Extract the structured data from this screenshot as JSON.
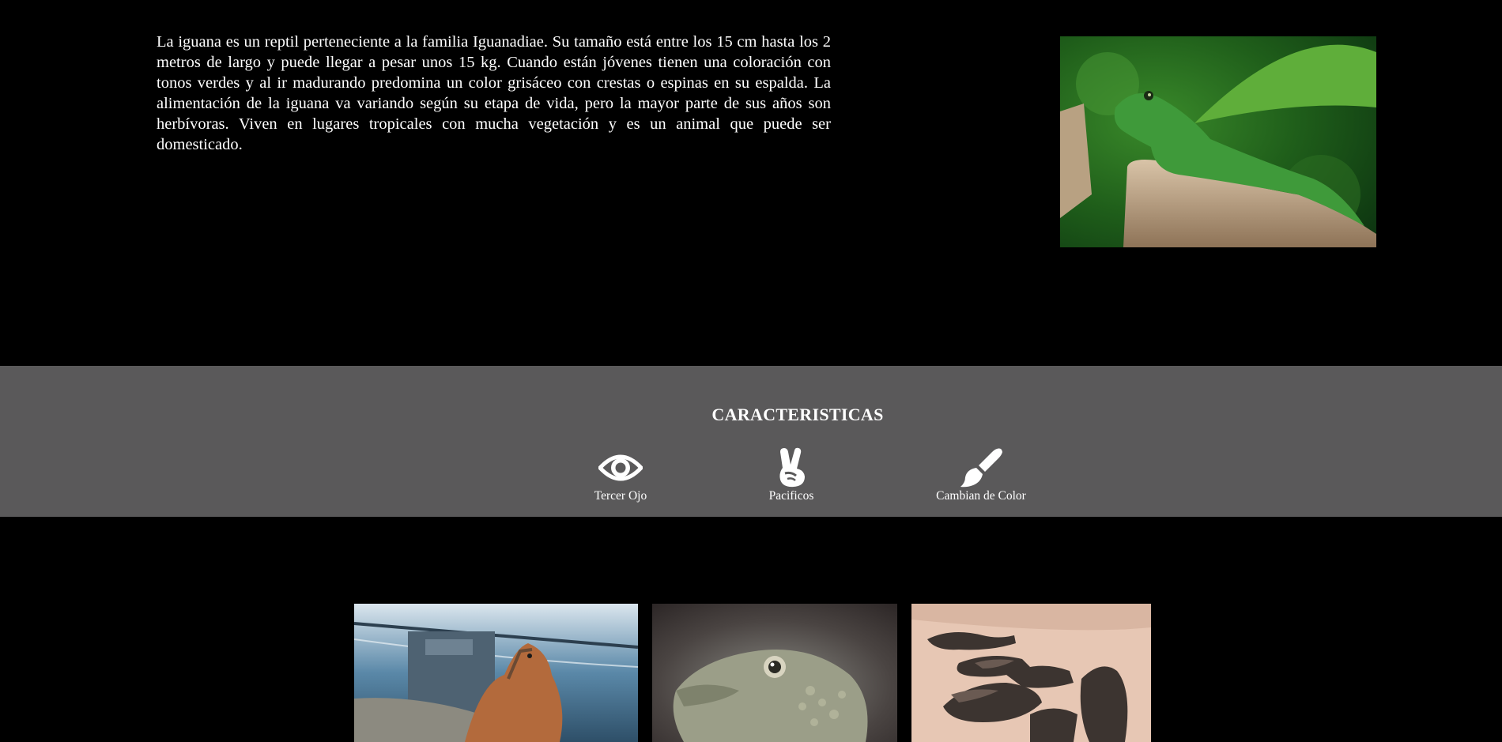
{
  "intro": {
    "text": "La iguana es un reptil perteneciente a la familia Iguanadiae. Su tamaño está entre los 15 cm hasta los 2 metros de largo y puede llegar a pesar unos 15 kg. Cuando están jóvenes tienen una coloración con tonos verdes y al ir madurando predomina un color grisáceo con crestas o espinas en su espalda. La alimentación de la iguana va variando según su etapa de vida, pero la mayor parte de sus años son herbívoras. Viven en lugares tropicales con mucha vegetación y es un animal que puede ser domesticado."
  },
  "features": {
    "title": "CARACTERISTICAS",
    "items": [
      {
        "icon": "eye-icon",
        "label": "Tercer Ojo"
      },
      {
        "icon": "peace-hand-icon",
        "label": "Pacificos"
      },
      {
        "icon": "paintbrush-icon",
        "label": "Cambian de Color"
      }
    ]
  },
  "colors": {
    "page_background": "#000000",
    "band_background": "#5a595a",
    "text": "#ffffff"
  }
}
